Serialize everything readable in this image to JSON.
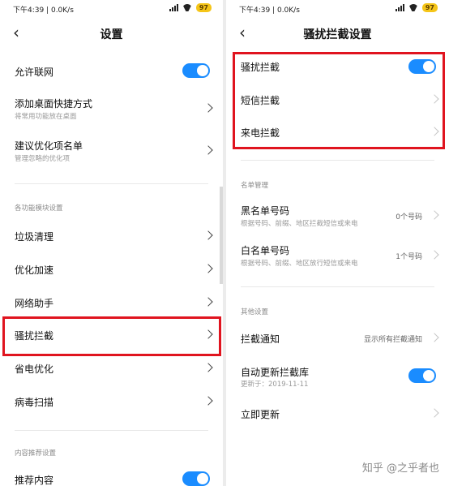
{
  "status": {
    "text": "下午4:39 | 0.0K/s",
    "battery": "97"
  },
  "left": {
    "title": "设置",
    "rows": [
      {
        "label": "允许联网"
      },
      {
        "label": "添加桌面快捷方式",
        "sub": "将常用功能放在桌面"
      },
      {
        "label": "建议优化项名单",
        "sub": "管理忽略的优化项"
      },
      {
        "label": "垃圾清理"
      },
      {
        "label": "优化加速"
      },
      {
        "label": "网络助手"
      },
      {
        "label": "骚扰拦截"
      },
      {
        "label": "省电优化"
      },
      {
        "label": "病毒扫描"
      },
      {
        "label": "推荐内容"
      }
    ],
    "sections": [
      "各功能模块设置",
      "内容推荐设置"
    ]
  },
  "right": {
    "title": "骚扰拦截设置",
    "rows": [
      {
        "label": "骚扰拦截"
      },
      {
        "label": "短信拦截"
      },
      {
        "label": "来电拦截"
      },
      {
        "label": "黑名单号码",
        "sub": "根据号码、前缀、地区拦截短信或来电",
        "value": "0个号码"
      },
      {
        "label": "白名单号码",
        "sub": "根据号码、前缀、地区放行短信或来电",
        "value": "1个号码"
      },
      {
        "label": "拦截通知",
        "value": "显示所有拦截通知"
      },
      {
        "label": "自动更新拦截库",
        "sub": "更新于：2019-11-11"
      },
      {
        "label": "立即更新"
      }
    ],
    "sections": [
      "名单管理",
      "其他设置"
    ]
  },
  "watermark": "知乎 @之乎者也",
  "colors": {
    "accent": "#1a8cff",
    "highlight": "#e0141f",
    "battery": "#f5c518"
  }
}
